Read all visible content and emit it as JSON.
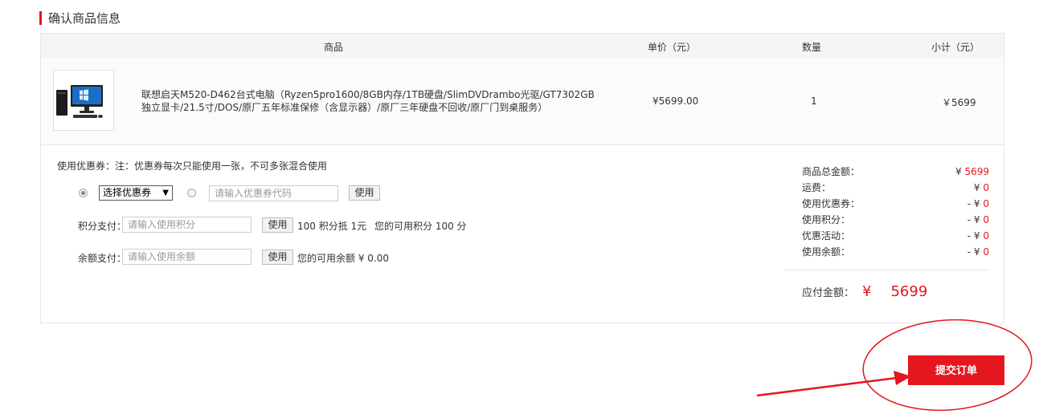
{
  "section": {
    "title": "确认商品信息"
  },
  "table": {
    "headers": {
      "goods": "商品",
      "unit_price": "单价（元）",
      "quantity": "数量",
      "subtotal": "小计（元）"
    },
    "items": [
      {
        "name": "联想启天M520-D462台式电脑（Ryzen5pro1600/8GB内存/1TB硬盘/SlimDVDrambo光驱/GT7302GB独立显卡/21.5寸/DOS/原厂五年标准保修（含显示器）/原厂三年硬盘不回收/原厂门到桌服务）",
        "unit_price": "¥5699.00",
        "quantity": "1",
        "subtotal": "￥5699",
        "image_icon": "desktop-computer-icon"
      }
    ]
  },
  "payment": {
    "coupon_note": "使用优惠券：注：优惠券每次只能使用一张，不可多张混合使用",
    "coupon_select": "选择优惠券",
    "coupon_code_placeholder": "请输入优惠券代码",
    "coupon_use": "使用",
    "points_label": "积分支付：",
    "points_placeholder": "请输入使用积分",
    "points_use": "使用",
    "points_rate": "100 积分抵 1元",
    "points_available": "您的可用积分 100 分",
    "balance_label": "余额支付：",
    "balance_placeholder": "请输入使用余额",
    "balance_use": "使用",
    "balance_available": "您的可用余额 ¥ 0.00"
  },
  "summary": {
    "rows": [
      {
        "label": "商品总金额：",
        "prefix": "¥",
        "value": "5699"
      },
      {
        "label": "运费：",
        "prefix": "¥",
        "value": "0"
      },
      {
        "label": "使用优惠券：",
        "prefix": "- ¥",
        "value": "0"
      },
      {
        "label": "使用积分：",
        "prefix": "- ¥",
        "value": "0"
      },
      {
        "label": "优惠活动：",
        "prefix": "- ¥",
        "value": "0"
      },
      {
        "label": "使用余额：",
        "prefix": "- ¥",
        "value": "0"
      }
    ],
    "due_label": "应付金额：",
    "due_currency": "¥",
    "due_amount": "5699"
  },
  "actions": {
    "submit": "提交订单"
  },
  "colors": {
    "accent": "#e4161e",
    "border": "#e6e6e6",
    "header_bg": "#f5f5f5"
  }
}
